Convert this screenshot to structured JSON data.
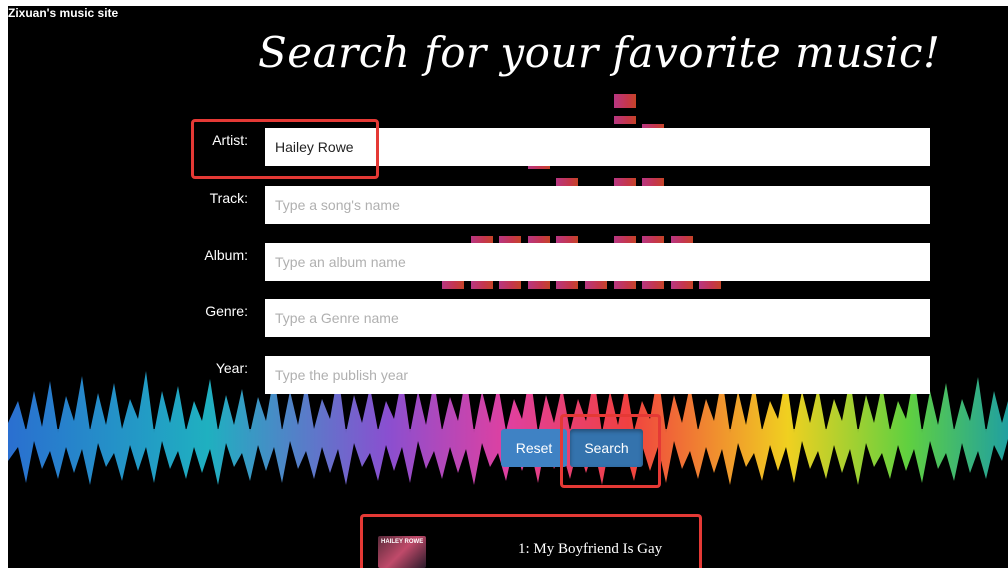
{
  "site_title": "Zixuan's music site",
  "heading": "Search for your favorite music!",
  "form": {
    "artist": {
      "label": "Artist:",
      "value": "Hailey Rowe",
      "placeholder": ""
    },
    "track": {
      "label": "Track:",
      "value": "",
      "placeholder": "Type a song's name"
    },
    "album": {
      "label": "Album:",
      "value": "",
      "placeholder": "Type an album name"
    },
    "genre": {
      "label": "Genre:",
      "value": "",
      "placeholder": "Type a Genre name"
    },
    "year": {
      "label": "Year:",
      "value": "",
      "placeholder": "Type the publish year"
    }
  },
  "buttons": {
    "reset_label": "Reset",
    "search_label": "Search"
  },
  "results": [
    {
      "title": "1: My Boyfriend Is Gay",
      "art_text": "HAILEY ROWE"
    }
  ],
  "colors": {
    "background": "#000000",
    "button_primary": "#3f82c4",
    "highlight": "#e53935",
    "equalizer": "#e0407f"
  }
}
